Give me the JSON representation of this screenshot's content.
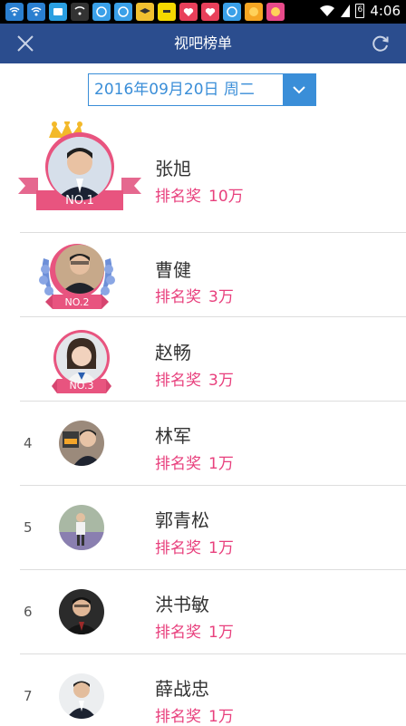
{
  "status": {
    "time": "4:06",
    "battery": "6"
  },
  "nav": {
    "title": "视吧榜单"
  },
  "date": {
    "value": "2016年09月20日 周二"
  },
  "ranking": [
    {
      "rank": "1",
      "badge": "NO.1",
      "name": "张旭",
      "prize_label": "排名奖",
      "prize_value": "10万"
    },
    {
      "rank": "2",
      "badge": "NO.2",
      "name": "曹健",
      "prize_label": "排名奖",
      "prize_value": "3万"
    },
    {
      "rank": "3",
      "badge": "NO.3",
      "name": "赵畅",
      "prize_label": "排名奖",
      "prize_value": "3万"
    },
    {
      "rank": "4",
      "name": "林军",
      "prize_label": "排名奖",
      "prize_value": "1万"
    },
    {
      "rank": "5",
      "name": "郭青松",
      "prize_label": "排名奖",
      "prize_value": "1万"
    },
    {
      "rank": "6",
      "name": "洪书敏",
      "prize_label": "排名奖",
      "prize_value": "1万"
    },
    {
      "rank": "7",
      "name": "薛战忠",
      "prize_label": "排名奖",
      "prize_value": "1万"
    }
  ],
  "colors": {
    "navbar": "#2b4d8e",
    "accent": "#3a8ed8",
    "prize": "#e8407d",
    "ribbon": "#e8547f",
    "laurel": "#6d8fd8",
    "crown": "#f3b92a"
  }
}
